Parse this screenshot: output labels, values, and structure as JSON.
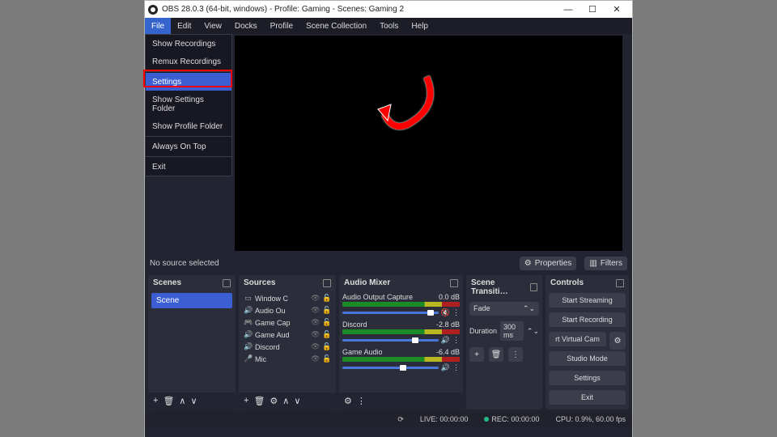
{
  "title": "OBS 28.0.3 (64-bit, windows) - Profile: Gaming - Scenes: Gaming 2",
  "menubar": [
    "File",
    "Edit",
    "View",
    "Docks",
    "Profile",
    "Scene Collection",
    "Tools",
    "Help"
  ],
  "filemenu": {
    "items": [
      "Show Recordings",
      "Remux Recordings",
      "Settings",
      "Show Settings Folder",
      "Show Profile Folder",
      "Always On Top",
      "Exit"
    ],
    "selected_index": 2
  },
  "sourcebar": {
    "no_source": "No source selected",
    "properties": "Properties",
    "filters": "Filters"
  },
  "docks": {
    "scenes": {
      "title": "Scenes",
      "items": [
        "Scene"
      ]
    },
    "sources": {
      "title": "Sources",
      "items": [
        {
          "icon": "▭",
          "name": "Window C"
        },
        {
          "icon": "🔊",
          "name": "Audio Ou"
        },
        {
          "icon": "🎮",
          "name": "Game Cap"
        },
        {
          "icon": "🔊",
          "name": "Game Aud"
        },
        {
          "icon": "🔊",
          "name": "Discord"
        },
        {
          "icon": "🎤",
          "name": "Mic"
        }
      ]
    },
    "mixer": {
      "title": "Audio Mixer",
      "channels": [
        {
          "name": "Audio Output Capture",
          "db": "0.0 dB",
          "knob": 88,
          "muted": true
        },
        {
          "name": "Discord",
          "db": "-2.8 dB",
          "knob": 72,
          "muted": false
        },
        {
          "name": "Game Audio",
          "db": "-6.4 dB",
          "knob": 60,
          "muted": false
        }
      ]
    },
    "transitions": {
      "title": "Scene Transiti…",
      "type": "Fade",
      "duration_label": "Duration",
      "duration": "300 ms"
    },
    "controls": {
      "title": "Controls",
      "buttons": [
        "Start Streaming",
        "Start Recording",
        "rt Virtual Cam",
        "Studio Mode",
        "Settings",
        "Exit"
      ]
    }
  },
  "status": {
    "live": "LIVE: 00:00:00",
    "rec": "REC: 00:00:00",
    "cpu": "CPU: 0.9%, 60.00 fps"
  }
}
